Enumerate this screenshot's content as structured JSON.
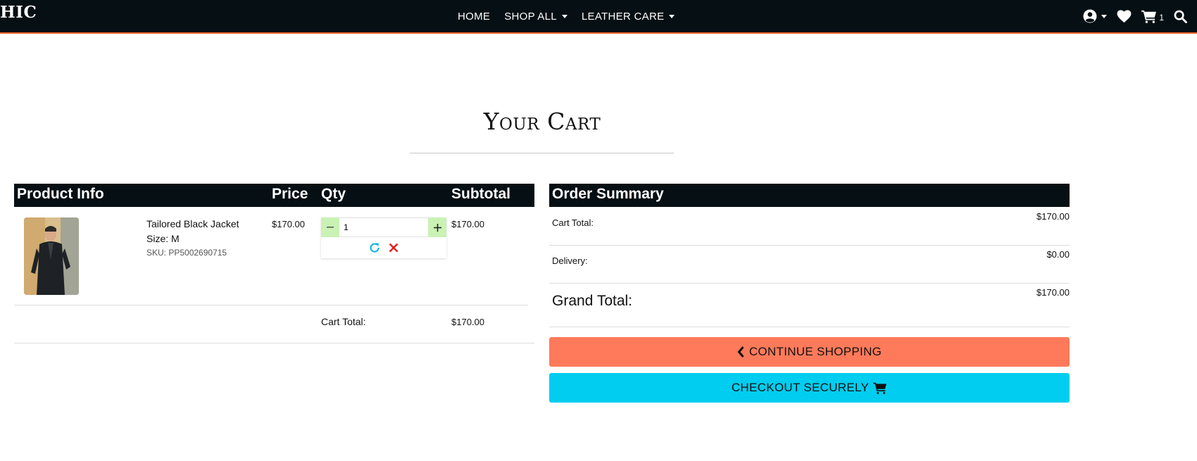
{
  "nav": {
    "brand": "HIC",
    "links": [
      {
        "label": "HOME",
        "has_dropdown": false
      },
      {
        "label": "SHOP ALL",
        "has_dropdown": true
      },
      {
        "label": "LEATHER CARE",
        "has_dropdown": true
      }
    ],
    "cart_count": "1",
    "icons": [
      "user-icon",
      "heart-icon",
      "cart-icon",
      "search-icon"
    ]
  },
  "page": {
    "title": "Your Cart"
  },
  "cart": {
    "headers": {
      "product": "Product Info",
      "price": "Price",
      "qty": "Qty",
      "subtotal": "Subtotal"
    },
    "items": [
      {
        "name": "Tailored Black Jacket",
        "size": "Size: M",
        "sku": "SKU: PP5002690715",
        "price": "$170.00",
        "qty": "1",
        "subtotal": "$170.00"
      }
    ],
    "total_label": "Cart Total:",
    "total_value": "$170.00"
  },
  "summary": {
    "title": "Order Summary",
    "cart_total_label": "Cart Total:",
    "cart_total_value": "$170.00",
    "delivery_label": "Delivery:",
    "delivery_value": "$0.00",
    "grand_total_label": "Grand Total:",
    "grand_total_value": "$170.00",
    "continue_label": "CONTINUE SHOPPING",
    "checkout_label": "CHECKOUT SECURELY"
  },
  "colors": {
    "navbar": "#050f14",
    "accent_orange": "#ff6a2e",
    "continue_button": "#ff7a5a",
    "checkout_button": "#00cdef",
    "qty_button": "#c9f2b4"
  }
}
